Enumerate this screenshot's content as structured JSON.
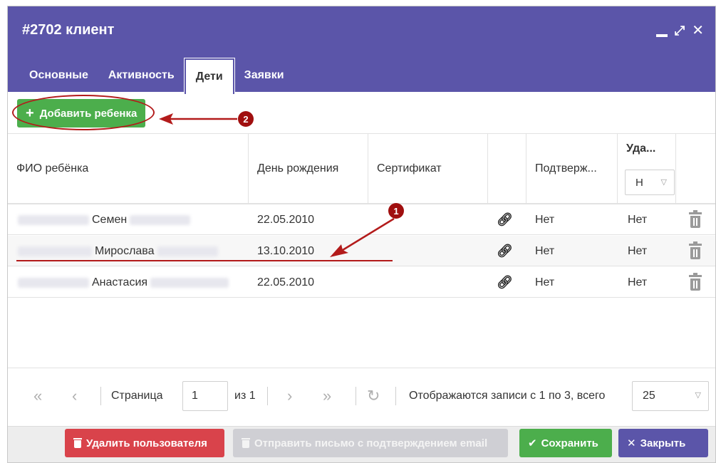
{
  "window": {
    "title": "#2702 клиент"
  },
  "tabs": [
    {
      "label": "Основные",
      "active": false
    },
    {
      "label": "Активность",
      "active": false
    },
    {
      "label": "Дети",
      "active": true
    },
    {
      "label": "Заявки",
      "active": false
    }
  ],
  "toolbar": {
    "add_child_label": "Добавить ребенка"
  },
  "grid": {
    "columns": {
      "name": "ФИО ребёнка",
      "birthday": "День рождения",
      "certificate": "Сертификат",
      "confirmed": "Подтверж...",
      "deleted": "Уда..."
    },
    "deleted_filter_value": "Н",
    "rows": [
      {
        "name_visible": "Семен",
        "birthday": "22.05.2010",
        "confirmed": "Нет",
        "deleted": "Нет"
      },
      {
        "name_visible": "Мирослава",
        "birthday": "13.10.2010",
        "confirmed": "Нет",
        "deleted": "Нет"
      },
      {
        "name_visible": "Анастасия",
        "birthday": "22.05.2010",
        "confirmed": "Нет",
        "deleted": "Нет"
      }
    ]
  },
  "annotations": {
    "badge1": "1",
    "badge2": "2",
    "color": "#b31b1b"
  },
  "pager": {
    "page_label": "Страница",
    "page_value": "1",
    "of_label": "из 1",
    "records_text": "Отображаются записи с 1 по 3, всего",
    "page_size": "25"
  },
  "footer": {
    "delete_user": "Удалить пользователя",
    "send_email": "Отправить письмо с подтверждением email",
    "save": "Сохранить",
    "close": "Закрыть"
  },
  "colors": {
    "header": "#5b55a9",
    "success": "#4cae4c",
    "danger": "#d9434b"
  }
}
